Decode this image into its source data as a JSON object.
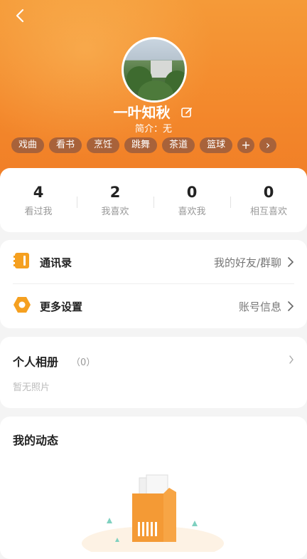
{
  "profile": {
    "name": "一叶知秋",
    "intro": "简介：无",
    "tags": [
      "戏曲",
      "看书",
      "烹饪",
      "跳舞",
      "茶道",
      "篮球"
    ],
    "add_tag": "+",
    "more_tags": "›"
  },
  "stats": [
    {
      "value": "4",
      "label": "看过我"
    },
    {
      "value": "2",
      "label": "我喜欢"
    },
    {
      "value": "0",
      "label": "喜欢我"
    },
    {
      "value": "0",
      "label": "相互喜欢"
    }
  ],
  "menu": {
    "contacts": {
      "title": "通讯录",
      "right": "我的好友/群聊"
    },
    "settings": {
      "title": "更多设置",
      "right": "账号信息"
    }
  },
  "album": {
    "title": "个人相册",
    "count": "（0）",
    "empty": "暂无照片"
  },
  "feed": {
    "title": "我的动态"
  },
  "colors": {
    "accent": "#f3872b",
    "tag_bg": "#a8623a"
  }
}
